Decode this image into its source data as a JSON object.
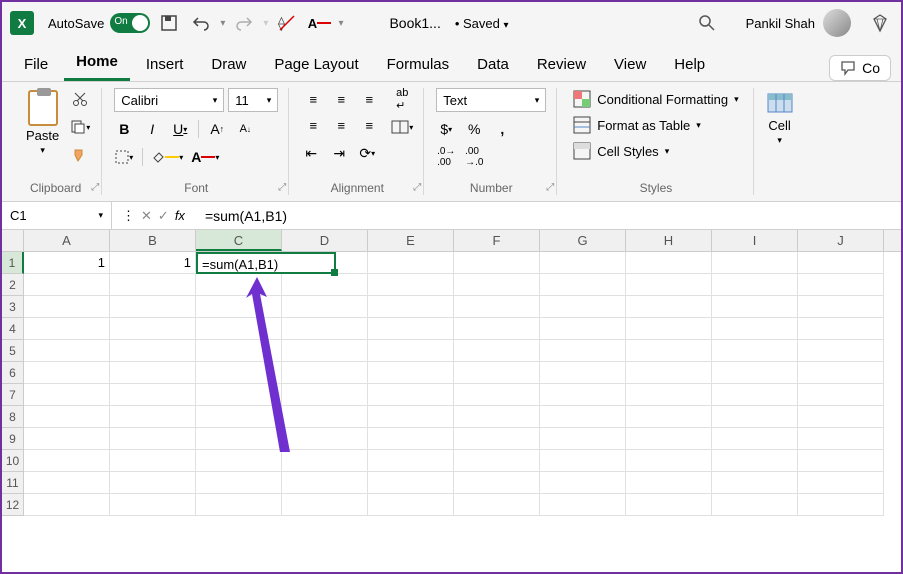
{
  "titlebar": {
    "autosave": "AutoSave",
    "autosave_state": "On",
    "doc_name": "Book1...",
    "saved": "• Saved",
    "user": "Pankil Shah"
  },
  "tabs": [
    "File",
    "Home",
    "Insert",
    "Draw",
    "Page Layout",
    "Formulas",
    "Data",
    "Review",
    "View",
    "Help"
  ],
  "active_tab": "Home",
  "ribbon": {
    "clipboard": {
      "paste": "Paste",
      "label": "Clipboard"
    },
    "font": {
      "name": "Calibri",
      "size": "11",
      "label": "Font"
    },
    "alignment": {
      "label": "Alignment"
    },
    "number": {
      "format": "Text",
      "label": "Number"
    },
    "styles": {
      "cond": "Conditional Formatting",
      "table": "Format as Table",
      "cell": "Cell Styles",
      "label": "Styles"
    },
    "cells": {
      "label": "Cell"
    },
    "comments": "Co"
  },
  "formula_bar": {
    "name_box": "C1",
    "formula": "=sum(A1,B1)"
  },
  "columns": [
    "A",
    "B",
    "C",
    "D",
    "E",
    "F",
    "G",
    "H",
    "I",
    "J"
  ],
  "rows": [
    "1",
    "2",
    "3",
    "4",
    "5",
    "6",
    "7",
    "8",
    "9",
    "10",
    "11",
    "12"
  ],
  "cells": {
    "A1": "1",
    "B1": "1",
    "C1": "=sum(A1,B1)"
  },
  "active_cell": "C1"
}
